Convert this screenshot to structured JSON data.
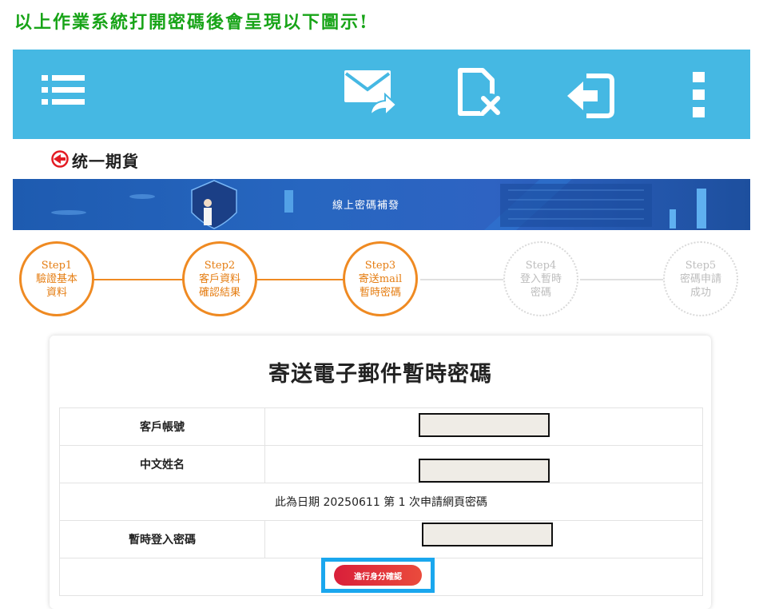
{
  "caption": "以上作業系統打開密碼後會呈現以下圖示!",
  "toolbar": {
    "icons": [
      "menu-icon",
      "mail-forward-icon",
      "delete-file-icon",
      "login-icon",
      "more-vertical-icon"
    ],
    "color": "#45b8e3"
  },
  "brand": {
    "name": "统一期貨",
    "color": "#e31b23"
  },
  "banner": {
    "title": "線上密碼補發"
  },
  "steps": [
    {
      "line1": "Step1",
      "line2": "驗證基本",
      "line3": "資料",
      "state": "done"
    },
    {
      "line1": "Step2",
      "line2": "客戶資料",
      "line3": "確認結果",
      "state": "done"
    },
    {
      "line1": "Step3",
      "line2": "寄送mail",
      "line3": "暫時密碼",
      "state": "done"
    },
    {
      "line1": "Step4",
      "line2": "登入暫時",
      "line3": "密碼",
      "state": "todo"
    },
    {
      "line1": "Step5",
      "line2": "密碼申請",
      "line3": "成功",
      "state": "todo"
    }
  ],
  "form": {
    "title": "寄送電子郵件暫時密碼",
    "account_label": "客戶帳號",
    "name_label": "中文姓名",
    "notice": "此為日期 20250611 第 1 次申請網頁密碼",
    "temp_password_label": "暫時登入密碼",
    "confirm_button": "進行身分確認"
  },
  "colors": {
    "accent": "#ef8a22",
    "button": "#e53838",
    "highlight": "#1aa7ee"
  }
}
